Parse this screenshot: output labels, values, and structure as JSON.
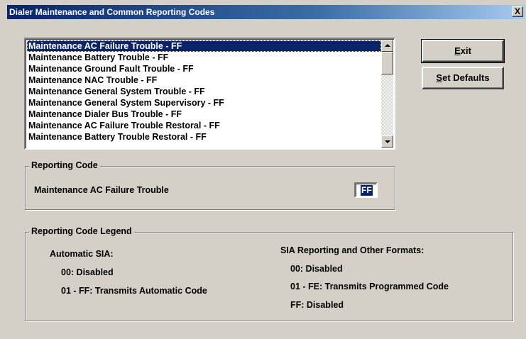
{
  "window": {
    "title": "Dialer Maintenance and Common Reporting Codes",
    "close_label": "X"
  },
  "list": {
    "items": [
      "Maintenance AC Failure Trouble - FF",
      "Maintenance Battery Trouble - FF",
      "Maintenance Ground Fault Trouble - FF",
      "Maintenance NAC Trouble - FF",
      "Maintenance General System Trouble - FF",
      "Maintenance General System Supervisory - FF",
      "Maintenance Dialer Bus Trouble - FF",
      "Maintenance AC Failure Trouble Restoral - FF",
      "Maintenance Battery Trouble Restoral - FF"
    ],
    "selected_index": 0
  },
  "buttons": {
    "exit_mnemonic": "E",
    "exit_rest": "xit",
    "defaults_mnemonic": "S",
    "defaults_rest": "et Defaults"
  },
  "reporting_code": {
    "group_title": "Reporting Code",
    "item_label": "Maintenance AC Failure Trouble",
    "value": "FF"
  },
  "legend": {
    "group_title": "Reporting Code Legend",
    "automatic_sia": {
      "heading": "Automatic SIA:",
      "line1": "00: Disabled",
      "line2": "01 - FF: Transmits Automatic Code"
    },
    "other_formats": {
      "heading": "SIA Reporting and Other Formats:",
      "line1": "00: Disabled",
      "line2": "01 - FE: Transmits Programmed Code",
      "line3": "FF: Disabled"
    }
  }
}
